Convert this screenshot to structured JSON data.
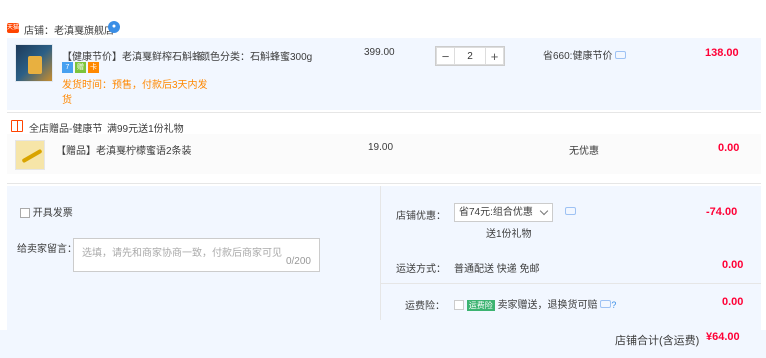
{
  "shop": {
    "badge": "天猫",
    "label": "店铺：",
    "name": "老滇戛旗舰店"
  },
  "items": [
    {
      "title": "【健康节价】老滇戛鲜榨石斛蜂...",
      "sku": "颜色分类：石斛蜂蜜300g",
      "unit_price": "399.00",
      "quantity": "2",
      "discount": "省660:健康节价",
      "subtotal": "138.00",
      "tags": [
        "7",
        "赠",
        "卡"
      ],
      "delivery_line1": "发货时间：预售，付款后3天内发",
      "delivery_line2": "货"
    }
  ],
  "gift": {
    "header": "全店赠品-健康节",
    "promo": "满99元送1份礼物",
    "title": "【赠品】老滇戛柠檬蜜语2条装",
    "unit_price": "19.00",
    "discount": "无优惠",
    "subtotal": "0.00"
  },
  "invoice": {
    "label": "开具发票"
  },
  "message": {
    "label": "给卖家留言：",
    "placeholder": "选填，请先和商家协商一致，付款后商家可见",
    "count": "0/200"
  },
  "shop_discount": {
    "label": "店铺优惠：",
    "selected": "省74元:组合优惠",
    "sub": "送1份礼物",
    "amount": "-74.00"
  },
  "shipping": {
    "label": "运送方式：",
    "value": "普通配送 快递 免邮",
    "amount": "0.00"
  },
  "insurance": {
    "label": "运费险：",
    "badge": "运费险",
    "value": "卖家赠送，退换货可赔",
    "amount": "0.00"
  },
  "total": {
    "label": "店铺合计(含运费)",
    "amount": "¥64.00"
  }
}
